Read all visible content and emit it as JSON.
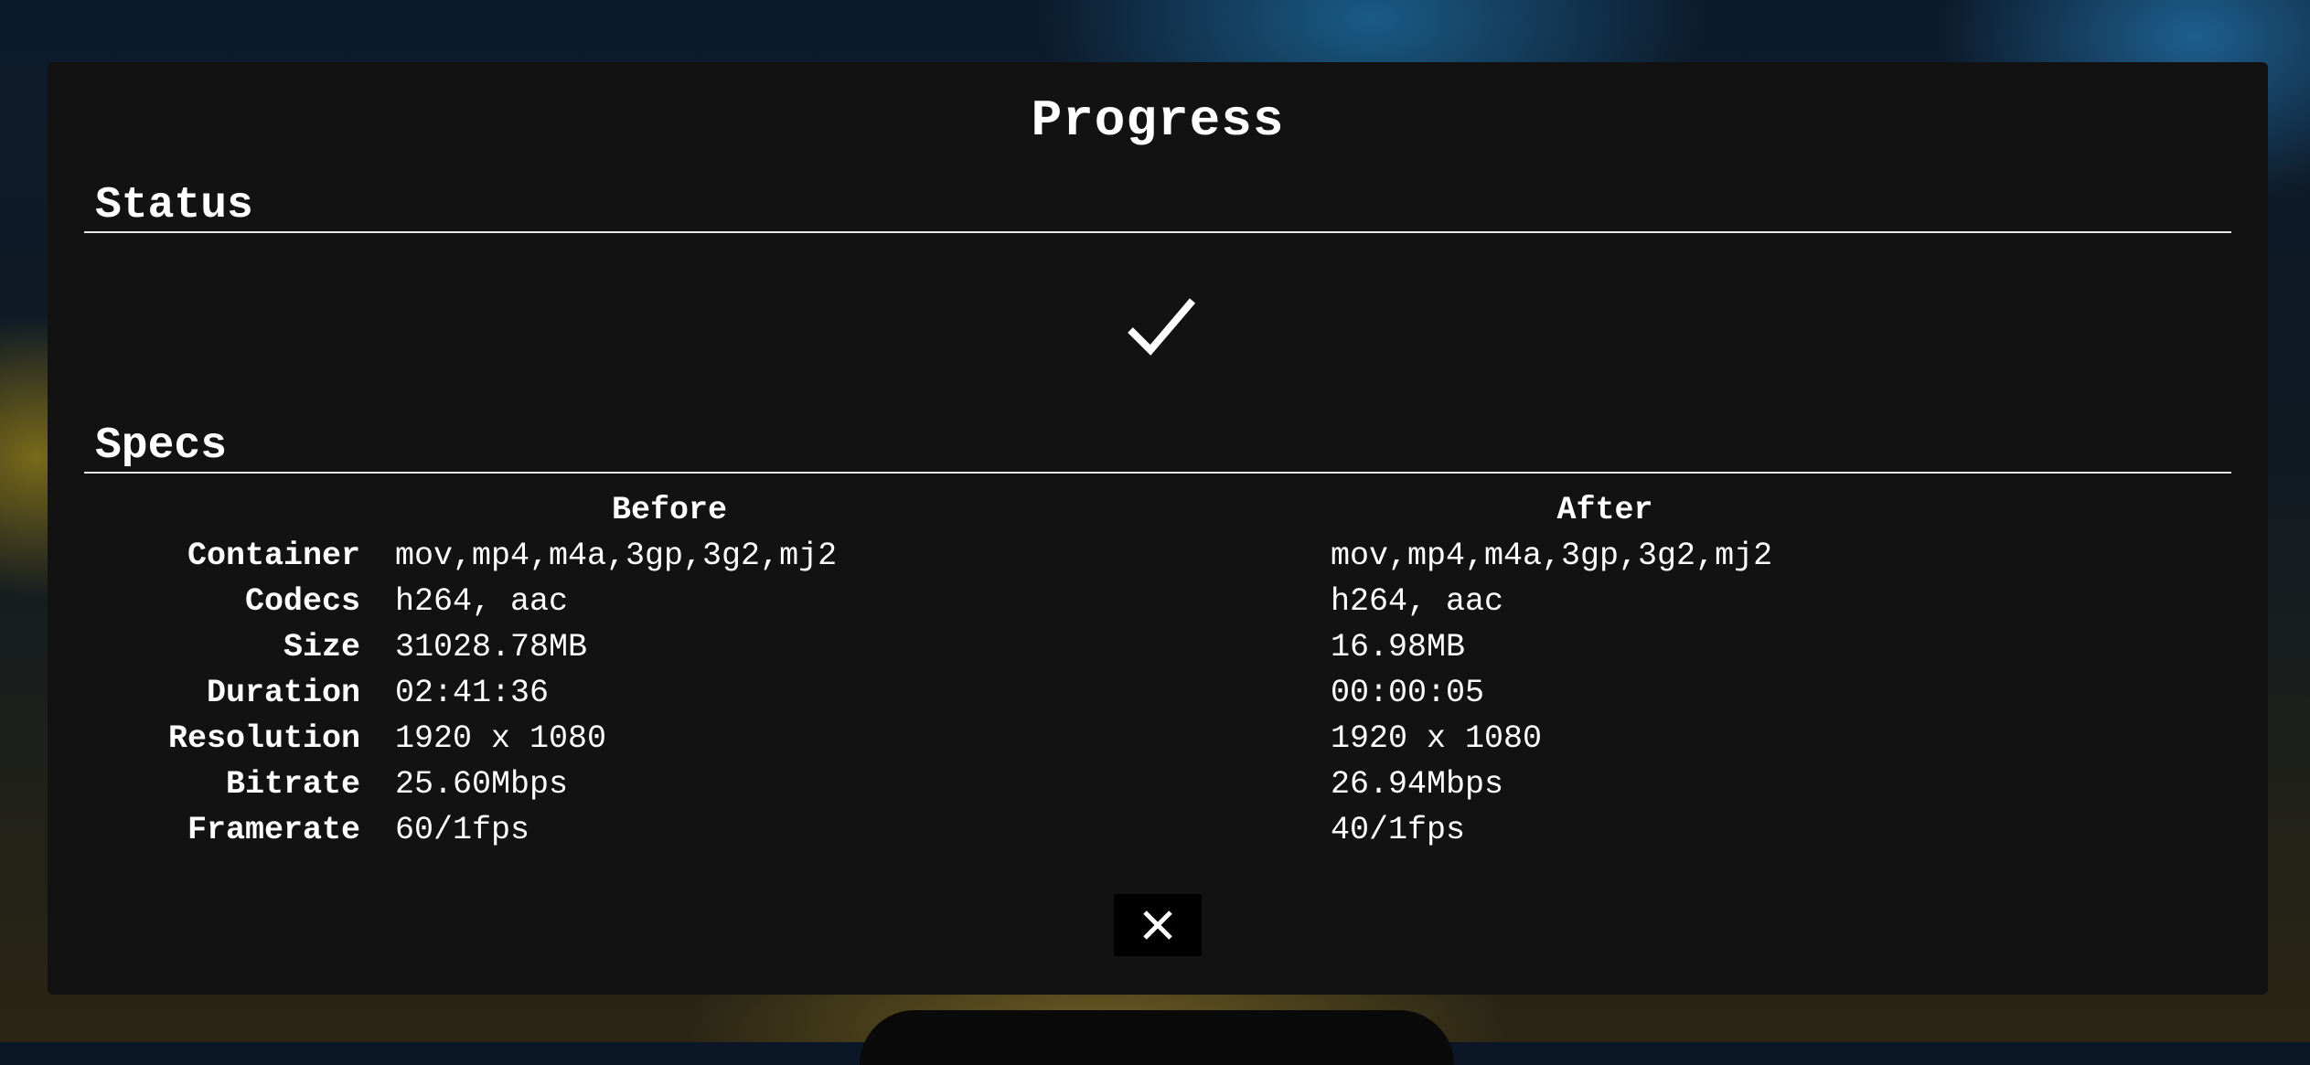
{
  "modal": {
    "title": "Progress"
  },
  "status": {
    "heading": "Status",
    "state_icon": "checkmark-icon"
  },
  "specs": {
    "heading": "Specs",
    "columns": {
      "before": "Before",
      "after": "After"
    },
    "rows": [
      {
        "label": "Container",
        "before": "mov,mp4,m4a,3gp,3g2,mj2",
        "after": "mov,mp4,m4a,3gp,3g2,mj2"
      },
      {
        "label": "Codecs",
        "before": "h264, aac",
        "after": "h264, aac"
      },
      {
        "label": "Size",
        "before": "31028.78MB",
        "after": "16.98MB"
      },
      {
        "label": "Duration",
        "before": "02:41:36",
        "after": "00:00:05"
      },
      {
        "label": "Resolution",
        "before": "1920 x 1080",
        "after": "1920 x 1080"
      },
      {
        "label": "Bitrate",
        "before": "25.60Mbps",
        "after": "26.94Mbps"
      },
      {
        "label": "Framerate",
        "before": "60/1fps",
        "after": "40/1fps"
      }
    ]
  },
  "close_button": {
    "icon": "close-icon"
  },
  "colors": {
    "modal_background": "#121212",
    "text": "#ffffff",
    "close_button_background": "#000000"
  }
}
